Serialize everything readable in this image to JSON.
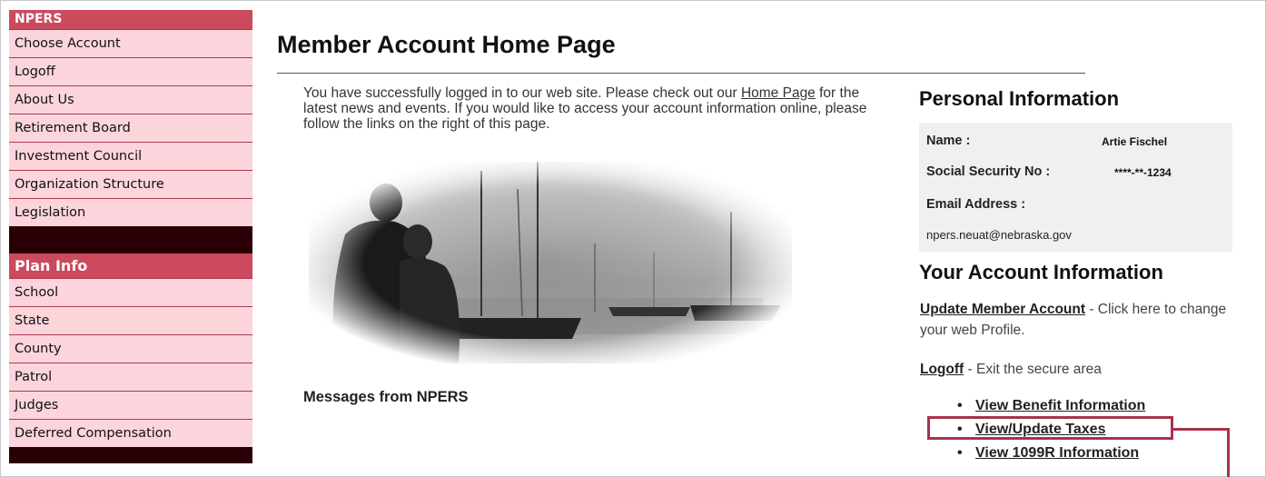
{
  "sidebar": {
    "section1_title": "NPERS",
    "section1_items": [
      "Choose Account",
      "Logoff",
      "About Us",
      "Retirement Board",
      "Investment Council",
      "Organization Structure",
      "Legislation"
    ],
    "section2_title": "Plan Info",
    "section2_items": [
      "School",
      "State",
      "County",
      "Patrol",
      "Judges",
      "Deferred Compensation"
    ]
  },
  "main": {
    "title": "Member Account Home Page",
    "intro_before": "You have successfully logged in to our web site. Please check out our",
    "intro_link": "Home Page",
    "intro_after": "for the latest news and events. If you would like to access your account information online, please follow the links on the right of this page.",
    "messages_heading": "Messages from NPERS"
  },
  "personal": {
    "heading": "Personal Information",
    "name_label": "Name :",
    "name_value": "Artie Fischel",
    "ssn_label": "Social Security No :",
    "ssn_value": "****-**-1234",
    "email_label": "Email Address :",
    "email_value": "npers.neuat@nebraska.gov"
  },
  "account": {
    "heading": "Your Account Information",
    "update_link": "Update Member Account",
    "update_desc": "- Click here to change your web Profile.",
    "logoff_link": "Logoff",
    "logoff_desc": "- Exit the secure area",
    "links": [
      "View Benefit Information",
      "View/Update Taxes",
      "View 1099R Information"
    ]
  },
  "colors": {
    "accent": "#cc4a5e",
    "menu_bg": "#fbd5db",
    "dark": "#2a0006",
    "highlight": "#a8324a"
  }
}
